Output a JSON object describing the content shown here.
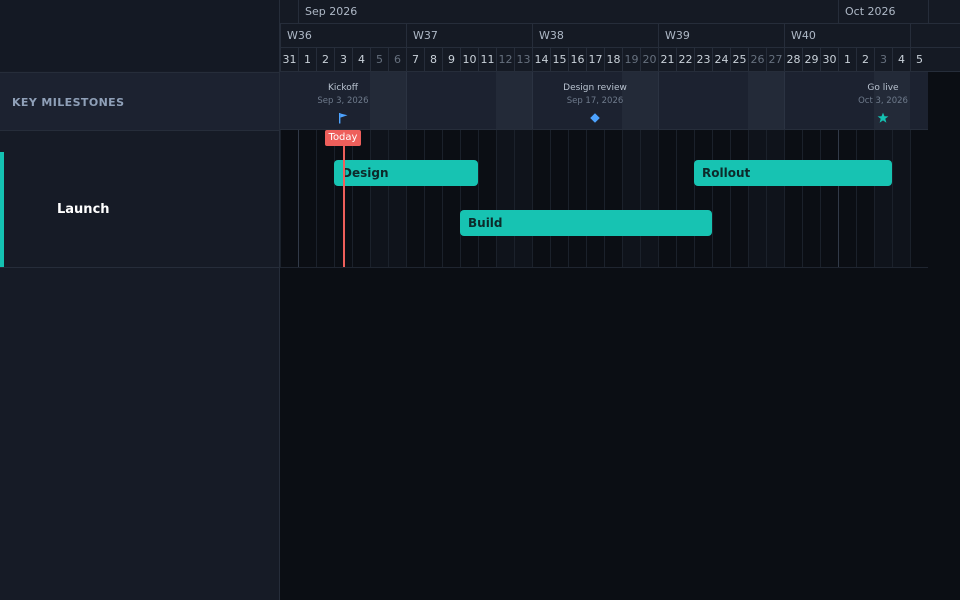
{
  "sidebar": {
    "milestones_label": "KEY MILESTONES",
    "groups": [
      {
        "name": "Launch"
      }
    ]
  },
  "timeline": {
    "months": [
      {
        "label": "Sep 2026"
      },
      {
        "label": "Oct 2026"
      }
    ],
    "weeks": [
      {
        "label": "W36"
      },
      {
        "label": "W37"
      },
      {
        "label": "W38"
      },
      {
        "label": "W39"
      },
      {
        "label": "W40"
      }
    ],
    "days": [
      "31",
      "1",
      "2",
      "3",
      "4",
      "5",
      "6",
      "7",
      "8",
      "9",
      "10",
      "11",
      "12",
      "13",
      "14",
      "15",
      "16",
      "17",
      "18",
      "19",
      "20",
      "21",
      "22",
      "23",
      "24",
      "25",
      "26",
      "27",
      "28",
      "29",
      "30",
      "1",
      "2",
      "3",
      "4",
      "5"
    ],
    "weekend_days": [
      5,
      6,
      12,
      13,
      19,
      20,
      26,
      27,
      3
    ]
  },
  "milestones": [
    {
      "title": "Kickoff",
      "date": "Sep 3, 2026",
      "icon": "flag-icon",
      "color": "#4da3ff"
    },
    {
      "title": "Design review",
      "date": "Sep 17, 2026",
      "icon": "diamond-icon",
      "color": "#4da3ff"
    },
    {
      "title": "Go live",
      "date": "Oct 3, 2026",
      "icon": "star-icon",
      "color": "#14c2b2"
    }
  ],
  "tasks": [
    {
      "label": "Design",
      "start": "Sep 3",
      "end": "Sep 10"
    },
    {
      "label": "Build",
      "start": "Sep 10",
      "end": "Sep 23"
    },
    {
      "label": "Rollout",
      "start": "Sep 23",
      "end": "Oct 3"
    }
  ],
  "today": {
    "label": "Today",
    "date": "Sep 3"
  },
  "colors": {
    "task": "#17c3b2",
    "today": "#ee5f5b",
    "accent": "#14c2b2"
  }
}
